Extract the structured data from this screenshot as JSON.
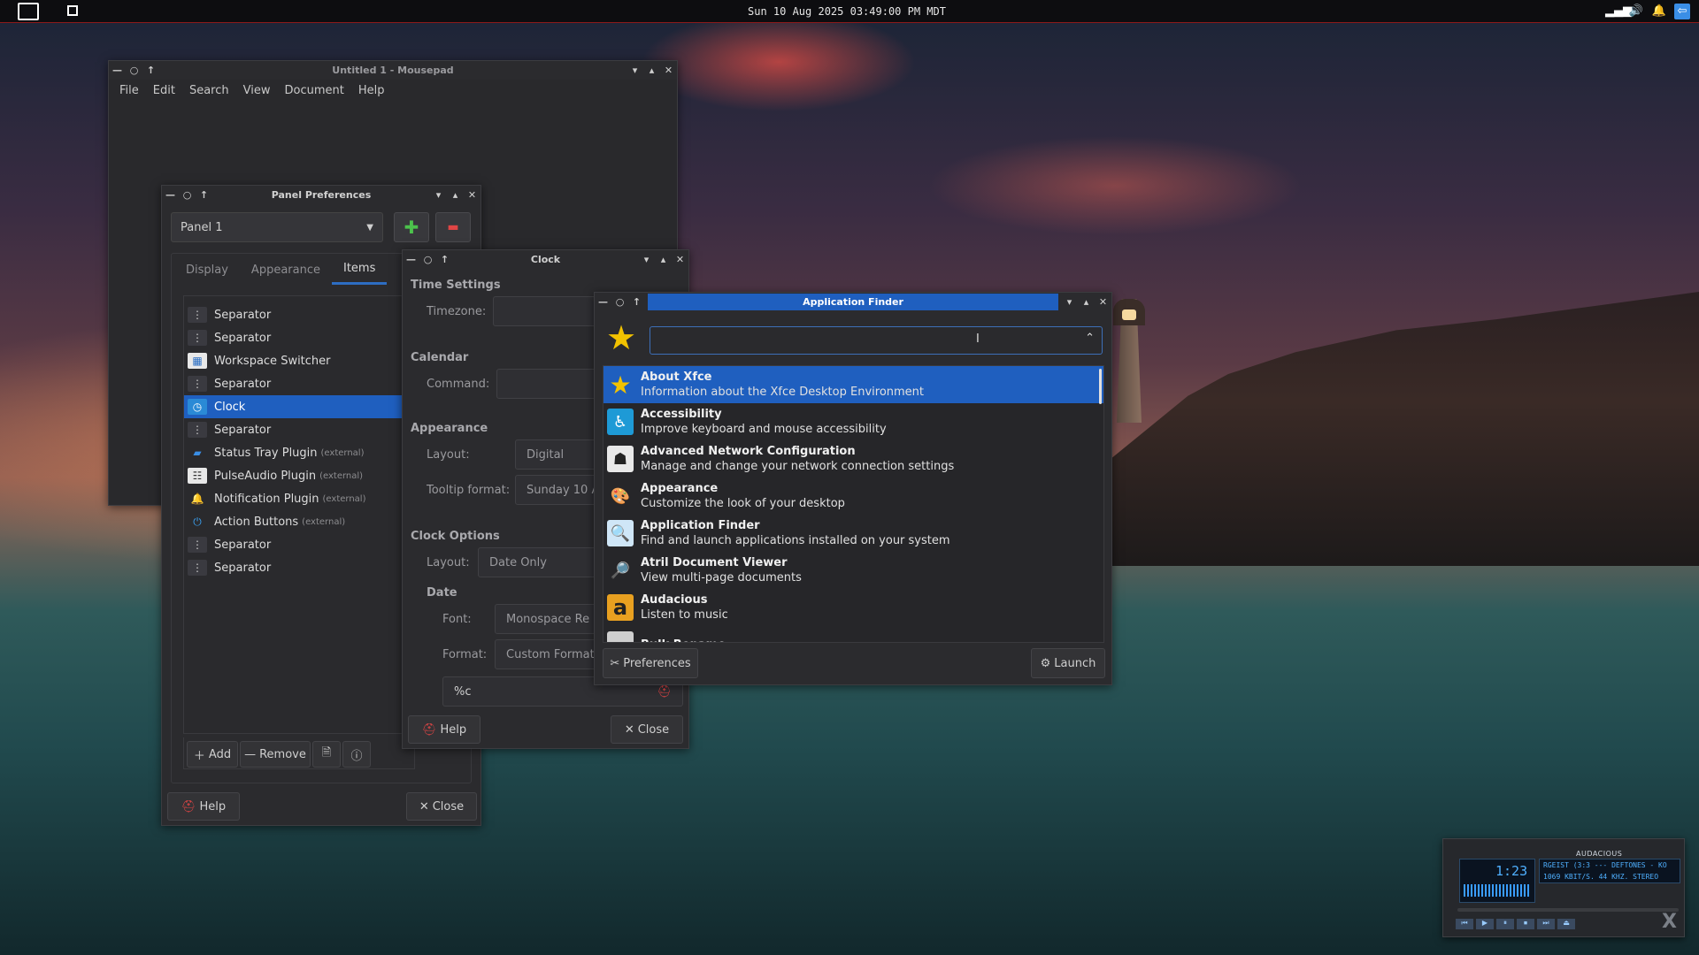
{
  "top_panel": {
    "clock": "Sun 10 Aug 2025 03:49:00 PM MDT",
    "tray_icons": [
      "signal-icon",
      "volume-icon",
      "bell-icon",
      "exit-icon"
    ]
  },
  "mousepad": {
    "title": "Untitled 1 - Mousepad",
    "menu": [
      "File",
      "Edit",
      "Search",
      "View",
      "Document",
      "Help"
    ]
  },
  "panel_prefs": {
    "title": "Panel Preferences",
    "panel_select": "Panel 1",
    "add_symbol": "✚",
    "remove_symbol": "▬",
    "tabs": [
      "Display",
      "Appearance",
      "Items"
    ],
    "items": [
      {
        "label": "Separator",
        "ext": "",
        "icon": "separator-icon"
      },
      {
        "label": "Separator",
        "ext": "",
        "icon": "separator-icon"
      },
      {
        "label": "Workspace Switcher",
        "ext": "",
        "icon": "workspace-icon"
      },
      {
        "label": "Separator",
        "ext": "",
        "icon": "separator-icon"
      },
      {
        "label": "Clock",
        "ext": "",
        "icon": "clock-icon"
      },
      {
        "label": "Separator",
        "ext": "",
        "icon": "separator-icon"
      },
      {
        "label": "Status Tray Plugin",
        "ext": "(external)",
        "icon": "tray-icon"
      },
      {
        "label": "PulseAudio Plugin",
        "ext": "(external)",
        "icon": "audio-icon"
      },
      {
        "label": "Notification Plugin",
        "ext": "(external)",
        "icon": "bell-icon"
      },
      {
        "label": "Action Buttons",
        "ext": "(external)",
        "icon": "power-icon"
      },
      {
        "label": "Separator",
        "ext": "",
        "icon": "separator-icon"
      },
      {
        "label": "Separator",
        "ext": "",
        "icon": "separator-icon"
      }
    ],
    "add_label": "Add",
    "remove_label": "Remove",
    "help_label": "Help",
    "close_label": "Close"
  },
  "clock": {
    "title": "Clock",
    "time_settings": "Time Settings",
    "timezone_label": "Timezone:",
    "calendar": "Calendar",
    "command_label": "Command:",
    "appearance": "Appearance",
    "layout_label": "Layout:",
    "layout_value": "Digital",
    "tooltip_label": "Tooltip format:",
    "tooltip_value": "Sunday 10 A",
    "clock_options": "Clock Options",
    "options_layout_label": "Layout:",
    "options_layout_value": "Date Only",
    "date": "Date",
    "font_label": "Font:",
    "font_value": "Monospace Re",
    "format_label": "Format:",
    "format_value": "Custom Format",
    "format_string": "%c",
    "help_label": "Help",
    "close_label": "Close"
  },
  "app_finder": {
    "title": "Application Finder",
    "search_value": "",
    "apps": [
      {
        "name": "About Xfce",
        "desc": "Information about the Xfce Desktop Environment",
        "icon": "star-icon",
        "selected": true
      },
      {
        "name": "Accessibility",
        "desc": "Improve keyboard and mouse accessibility",
        "icon": "accessibility-icon",
        "selected": false
      },
      {
        "name": "Advanced Network Configuration",
        "desc": "Manage and change your network connection settings",
        "icon": "network-icon",
        "selected": false
      },
      {
        "name": "Appearance",
        "desc": "Customize the look of your desktop",
        "icon": "palette-icon",
        "selected": false
      },
      {
        "name": "Application Finder",
        "desc": "Find and launch applications installed on your system",
        "icon": "magnifier-icon",
        "selected": false
      },
      {
        "name": "Atril Document Viewer",
        "desc": "View multi-page documents",
        "icon": "document-viewer-icon",
        "selected": false
      },
      {
        "name": "Audacious",
        "desc": "Listen to music",
        "icon": "audacious-icon",
        "selected": false
      },
      {
        "name": "Bulk Rename",
        "desc": "",
        "icon": "rename-icon",
        "selected": false
      }
    ],
    "preferences_label": "Preferences",
    "launch_label": "Launch"
  },
  "audacious": {
    "title": "AUDACIOUS",
    "time": "1:23",
    "track": "RGEIST (3:3 --- DEFTONES - KO",
    "info": "1069 KBIT/S. 44 KHZ. STEREO"
  }
}
